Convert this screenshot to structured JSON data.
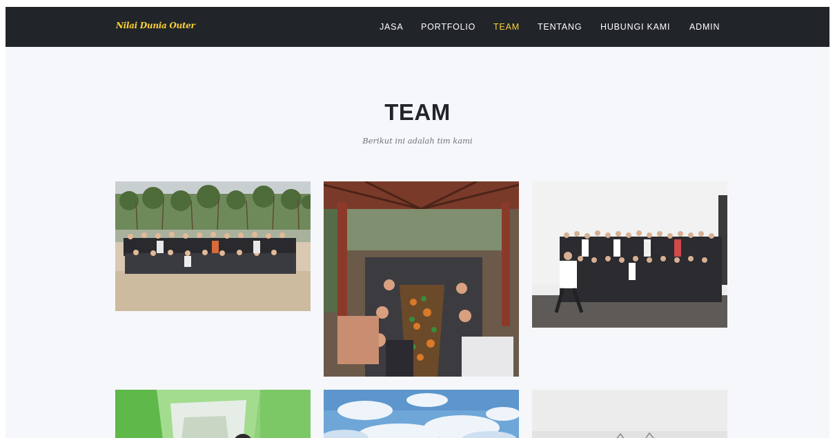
{
  "navbar": {
    "brand": "Nilai Dunia Outer",
    "items": [
      {
        "label": "JASA",
        "active": false
      },
      {
        "label": "PORTFOLIO",
        "active": false
      },
      {
        "label": "TEAM",
        "active": true
      },
      {
        "label": "TENTANG",
        "active": false
      },
      {
        "label": "HUBUNGI KAMI",
        "active": false
      },
      {
        "label": "ADMIN",
        "active": false
      }
    ],
    "accent_color": "#fed136",
    "background_color": "#212529"
  },
  "section": {
    "heading": "TEAM",
    "subheading": "Berikut ini adalah tim kami"
  },
  "gallery": {
    "photos": [
      {
        "subject": "team-photo-beach"
      },
      {
        "subject": "team-photo-gazebo-meal"
      },
      {
        "subject": "team-photo-indoor-group"
      },
      {
        "subject": "team-photo-tent"
      },
      {
        "subject": "team-photo-sky"
      },
      {
        "subject": "team-photo-grey"
      }
    ]
  }
}
